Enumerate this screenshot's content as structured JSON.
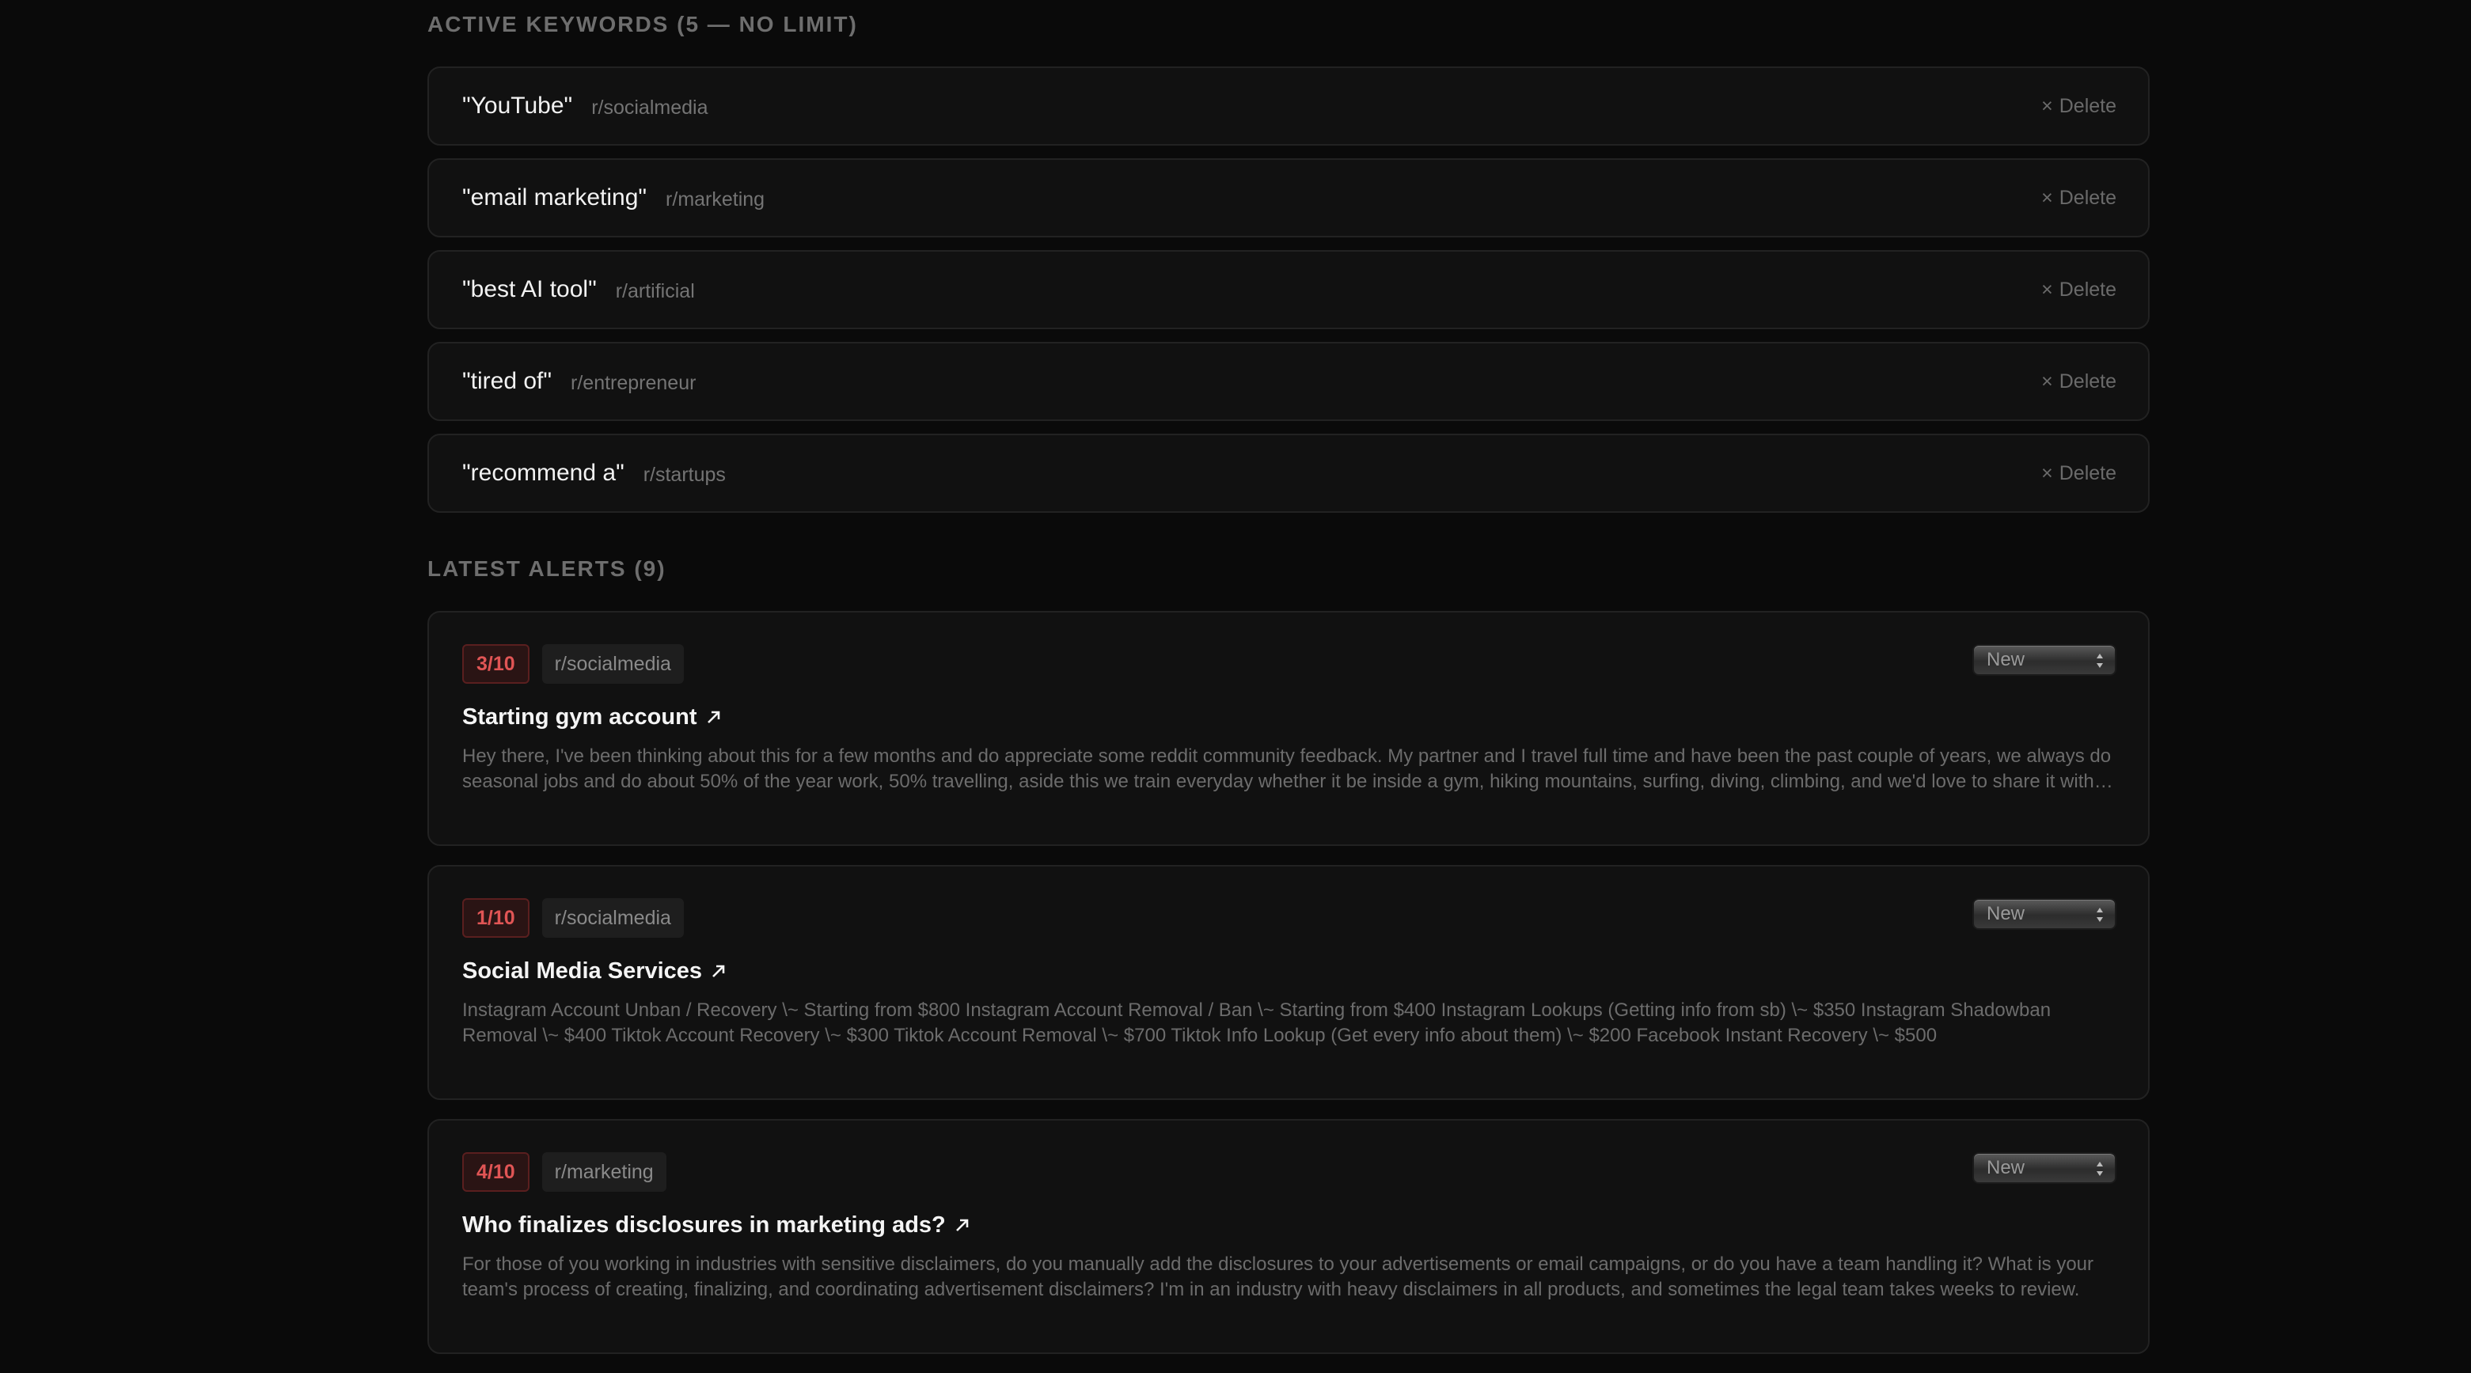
{
  "keywords_section": {
    "title": "ACTIVE KEYWORDS (5 — NO LIMIT)",
    "delete_label": "Delete",
    "items": [
      {
        "term": "\"YouTube\"",
        "subreddit": "r/socialmedia"
      },
      {
        "term": "\"email marketing\"",
        "subreddit": "r/marketing"
      },
      {
        "term": "\"best AI tool\"",
        "subreddit": "r/artificial"
      },
      {
        "term": "\"tired of\"",
        "subreddit": "r/entrepreneur"
      },
      {
        "term": "\"recommend a\"",
        "subreddit": "r/startups"
      }
    ]
  },
  "alerts_section": {
    "title": "LATEST ALERTS (9)",
    "items": [
      {
        "score": "3/10",
        "subreddit": "r/socialmedia",
        "title": "Starting gym account",
        "status": "New",
        "body": "Hey there, I've been thinking about this for a few months and do appreciate some reddit community feedback. My partner and I travel full time and have been the past couple of years, we always do seasonal jobs and do about 50% of the year work, 50% travelling, aside this we train everyday whether it be inside a gym, hiking mountains, surfing, diving, climbing, and we'd love to share it with people who might find it helpful."
      },
      {
        "score": "1/10",
        "subreddit": "r/socialmedia",
        "title": "Social Media Services",
        "status": "New",
        "body": "Instagram Account Unban / Recovery \\~ Starting from $800 Instagram Account Removal / Ban \\~ Starting from $400 Instagram Lookups (Getting info from sb) \\~ $350 Instagram Shadowban Removal \\~ $400 Tiktok Account Recovery \\~ $300 Tiktok Account Removal \\~ $700 Tiktok Info Lookup (Get every info about them) \\~ $200 Facebook Instant Recovery \\~ $500"
      },
      {
        "score": "4/10",
        "subreddit": "r/marketing",
        "title": "Who finalizes disclosures in marketing ads?",
        "status": "New",
        "body": "For those of you working in industries with sensitive disclaimers, do you manually add the disclosures to your advertisements or email campaigns, or do you have a team handling it? What is your team's process of creating, finalizing, and coordinating advertisement disclaimers? I'm in an industry with heavy disclaimers in all products, and sometimes the legal team takes weeks to review."
      }
    ]
  }
}
